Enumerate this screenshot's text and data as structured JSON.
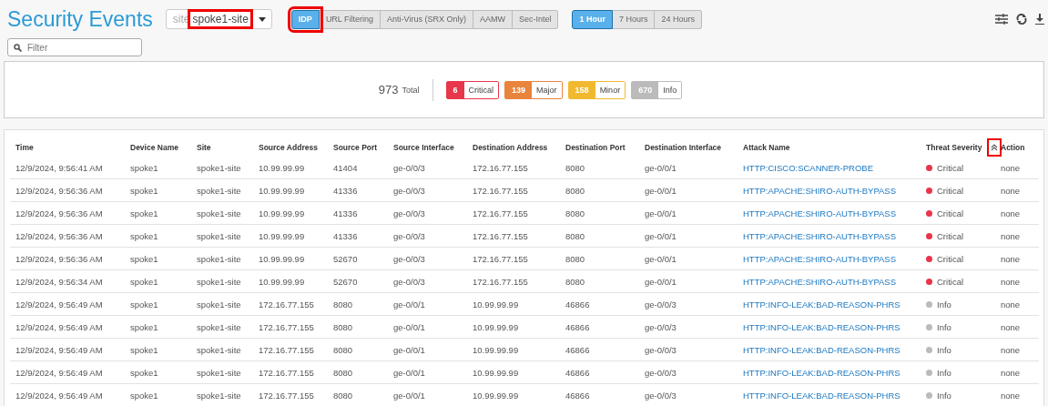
{
  "title": "Security Events",
  "site_select": {
    "label": "site",
    "value": "spoke1-site",
    "highlighted": true
  },
  "event_tabs": [
    {
      "label": "IDP",
      "selected": true,
      "highlighted": true
    },
    {
      "label": "URL Filtering",
      "selected": false,
      "highlighted": false
    },
    {
      "label": "Anti-Virus (SRX Only)",
      "selected": false,
      "highlighted": false
    },
    {
      "label": "AAMW",
      "selected": false,
      "highlighted": false
    },
    {
      "label": "Sec-Intel",
      "selected": false,
      "highlighted": false
    }
  ],
  "time_ranges": [
    {
      "label": "1 Hour",
      "selected": true
    },
    {
      "label": "7 Hours",
      "selected": false
    },
    {
      "label": "24 Hours",
      "selected": false
    }
  ],
  "filter": {
    "placeholder": "Filter"
  },
  "summary": {
    "total": "973",
    "total_label": "Total",
    "badges": [
      {
        "count": "6",
        "label": "Critical",
        "color": "#e8364a"
      },
      {
        "count": "139",
        "label": "Major",
        "color": "#e8843c"
      },
      {
        "count": "158",
        "label": "Minor",
        "color": "#f0b92f"
      },
      {
        "count": "670",
        "label": "Info",
        "color": "#bbbbbb"
      }
    ]
  },
  "table": {
    "columns": [
      "Time",
      "Device Name",
      "Site",
      "Source Address",
      "Source Port",
      "Source Interface",
      "Destination Address",
      "Destination Port",
      "Destination Interface",
      "Attack Name",
      "Threat Severity",
      "Action"
    ],
    "sort_highlighted": true,
    "rows": [
      [
        "12/9/2024, 9:56:41 AM",
        "spoke1",
        "spoke1-site",
        "10.99.99.99",
        "41404",
        "ge-0/0/3",
        "172.16.77.155",
        "8080",
        "ge-0/0/1",
        "HTTP:CISCO:SCANNER-PROBE",
        {
          "text": "Critical",
          "color": "#e8364a"
        },
        "none"
      ],
      [
        "12/9/2024, 9:56:36 AM",
        "spoke1",
        "spoke1-site",
        "10.99.99.99",
        "41336",
        "ge-0/0/3",
        "172.16.77.155",
        "8080",
        "ge-0/0/1",
        "HTTP:APACHE:SHIRO-AUTH-BYPASS",
        {
          "text": "Critical",
          "color": "#e8364a"
        },
        "none"
      ],
      [
        "12/9/2024, 9:56:36 AM",
        "spoke1",
        "spoke1-site",
        "10.99.99.99",
        "41336",
        "ge-0/0/3",
        "172.16.77.155",
        "8080",
        "ge-0/0/1",
        "HTTP:APACHE:SHIRO-AUTH-BYPASS",
        {
          "text": "Critical",
          "color": "#e8364a"
        },
        "none"
      ],
      [
        "12/9/2024, 9:56:36 AM",
        "spoke1",
        "spoke1-site",
        "10.99.99.99",
        "41336",
        "ge-0/0/3",
        "172.16.77.155",
        "8080",
        "ge-0/0/1",
        "HTTP:APACHE:SHIRO-AUTH-BYPASS",
        {
          "text": "Critical",
          "color": "#e8364a"
        },
        "none"
      ],
      [
        "12/9/2024, 9:56:36 AM",
        "spoke1",
        "spoke1-site",
        "10.99.99.99",
        "52670",
        "ge-0/0/3",
        "172.16.77.155",
        "8080",
        "ge-0/0/1",
        "HTTP:APACHE:SHIRO-AUTH-BYPASS",
        {
          "text": "Critical",
          "color": "#e8364a"
        },
        "none"
      ],
      [
        "12/9/2024, 9:56:34 AM",
        "spoke1",
        "spoke1-site",
        "10.99.99.99",
        "52670",
        "ge-0/0/3",
        "172.16.77.155",
        "8080",
        "ge-0/0/1",
        "HTTP:APACHE:SHIRO-AUTH-BYPASS",
        {
          "text": "Critical",
          "color": "#e8364a"
        },
        "none"
      ],
      [
        "12/9/2024, 9:56:49 AM",
        "spoke1",
        "spoke1-site",
        "172.16.77.155",
        "8080",
        "ge-0/0/1",
        "10.99.99.99",
        "46866",
        "ge-0/0/3",
        "HTTP:INFO-LEAK:BAD-REASON-PHRS",
        {
          "text": "Info",
          "color": "#bbbbbb"
        },
        "none"
      ],
      [
        "12/9/2024, 9:56:49 AM",
        "spoke1",
        "spoke1-site",
        "172.16.77.155",
        "8080",
        "ge-0/0/1",
        "10.99.99.99",
        "46866",
        "ge-0/0/3",
        "HTTP:INFO-LEAK:BAD-REASON-PHRS",
        {
          "text": "Info",
          "color": "#bbbbbb"
        },
        "none"
      ],
      [
        "12/9/2024, 9:56:49 AM",
        "spoke1",
        "spoke1-site",
        "172.16.77.155",
        "8080",
        "ge-0/0/1",
        "10.99.99.99",
        "46866",
        "ge-0/0/3",
        "HTTP:INFO-LEAK:BAD-REASON-PHRS",
        {
          "text": "Info",
          "color": "#bbbbbb"
        },
        "none"
      ],
      [
        "12/9/2024, 9:56:49 AM",
        "spoke1",
        "spoke1-site",
        "172.16.77.155",
        "8080",
        "ge-0/0/1",
        "10.99.99.99",
        "46866",
        "ge-0/0/3",
        "HTTP:INFO-LEAK:BAD-REASON-PHRS",
        {
          "text": "Info",
          "color": "#bbbbbb"
        },
        "none"
      ],
      [
        "12/9/2024, 9:56:49 AM",
        "spoke1",
        "spoke1-site",
        "172.16.77.155",
        "8080",
        "ge-0/0/1",
        "10.99.99.99",
        "46866",
        "ge-0/0/3",
        "HTTP:INFO-LEAK:BAD-REASON-PHRS",
        {
          "text": "Info",
          "color": "#bbbbbb"
        },
        "none"
      ]
    ]
  }
}
